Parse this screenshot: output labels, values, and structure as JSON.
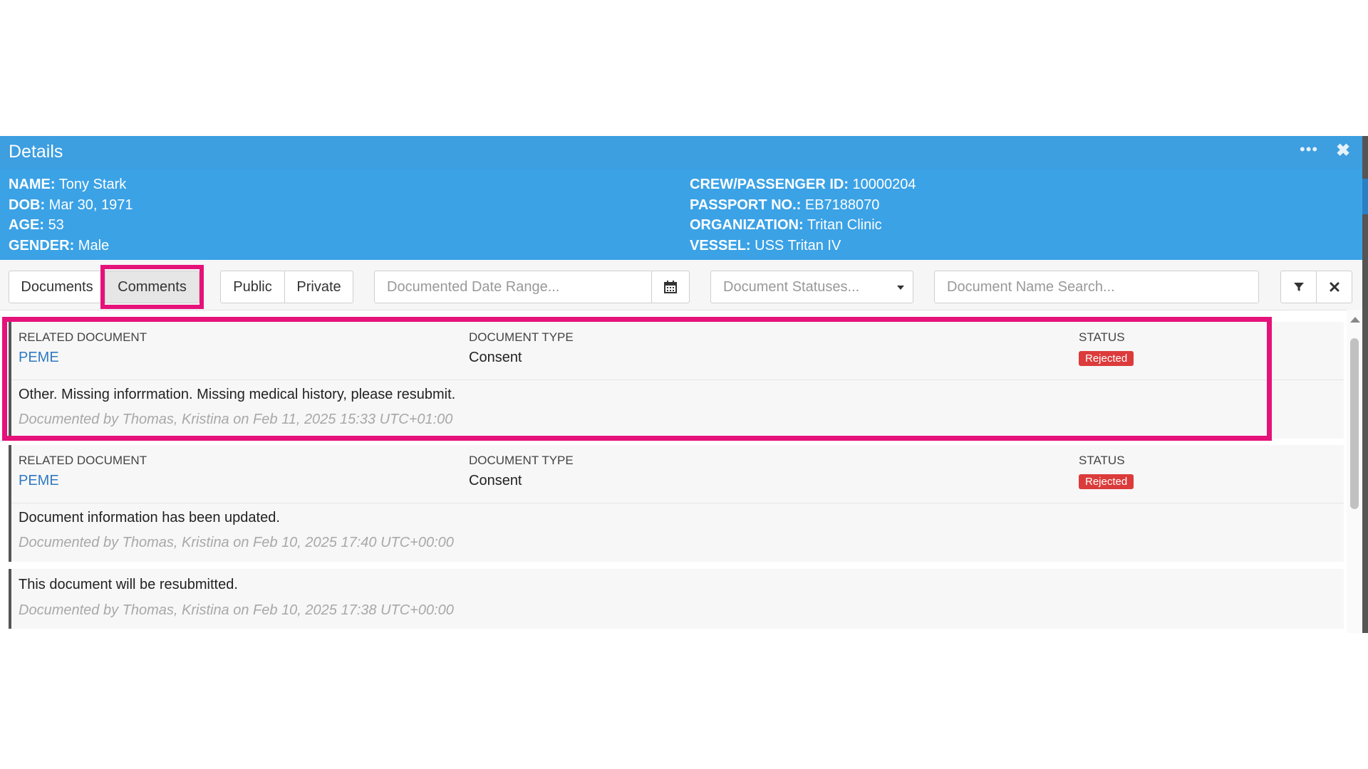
{
  "window": {
    "title": "Details",
    "more_label": "•••",
    "close_label": "✖"
  },
  "patient": {
    "name_label": "NAME:",
    "name": "Tony Stark",
    "dob_label": "DOB:",
    "dob": "Mar 30, 1971",
    "age_label": "AGE:",
    "age": "53",
    "gender_label": "GENDER:",
    "gender": "Male",
    "id_label": "CREW/PASSENGER ID:",
    "id": "10000204",
    "passport_label": "PASSPORT NO.:",
    "passport": "EB7188070",
    "org_label": "ORGANIZATION:",
    "org": "Tritan Clinic",
    "vessel_label": "VESSEL:",
    "vessel": "USS Tritan IV"
  },
  "toolbar": {
    "tab_documents": "Documents",
    "tab_comments": "Comments",
    "filter_public": "Public",
    "filter_private": "Private",
    "date_range_placeholder": "Documented Date Range...",
    "status_placeholder": "Document Statuses...",
    "name_search_placeholder": "Document Name Search..."
  },
  "columns": {
    "related": "RELATED DOCUMENT",
    "type": "DOCUMENT TYPE",
    "status": "STATUS"
  },
  "comments": [
    {
      "related": "PEME",
      "type": "Consent",
      "status": "Rejected",
      "text": "Other. Missing inforrmation. Missing medical history, please resubmit.",
      "meta": "Documented by Thomas, Kristina on Feb 11, 2025 15:33 UTC+01:00"
    },
    {
      "related": "PEME",
      "type": "Consent",
      "status": "Rejected",
      "text": "Document information has been updated.",
      "meta": "Documented by Thomas, Kristina on Feb 10, 2025 17:40 UTC+00:00"
    },
    {
      "text": "This document will be resubmitted.",
      "meta": "Documented by Thomas, Kristina on Feb 10, 2025 17:38 UTC+00:00"
    }
  ],
  "colors": {
    "header": "#3d9ee0",
    "info": "#3ba2e6",
    "highlight": "#e5127a",
    "badge": "#dc3b3b",
    "link": "#2f7ac2"
  }
}
